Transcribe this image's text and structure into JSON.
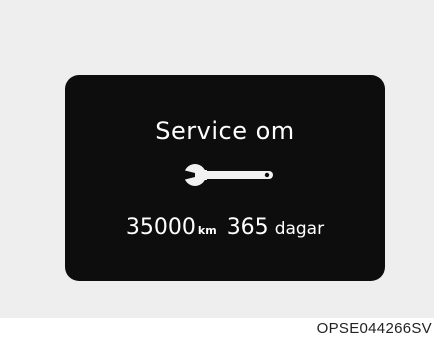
{
  "display": {
    "title": "Service om",
    "distance_value": "35000",
    "distance_unit": "km",
    "days_value": "365",
    "days_unit": "dagar",
    "icon": "wrench-icon",
    "colors": {
      "screen": "#0d0d0d",
      "text": "#ffffff",
      "frame": "#eeeeee"
    }
  },
  "caption": "OPSE044266SV"
}
